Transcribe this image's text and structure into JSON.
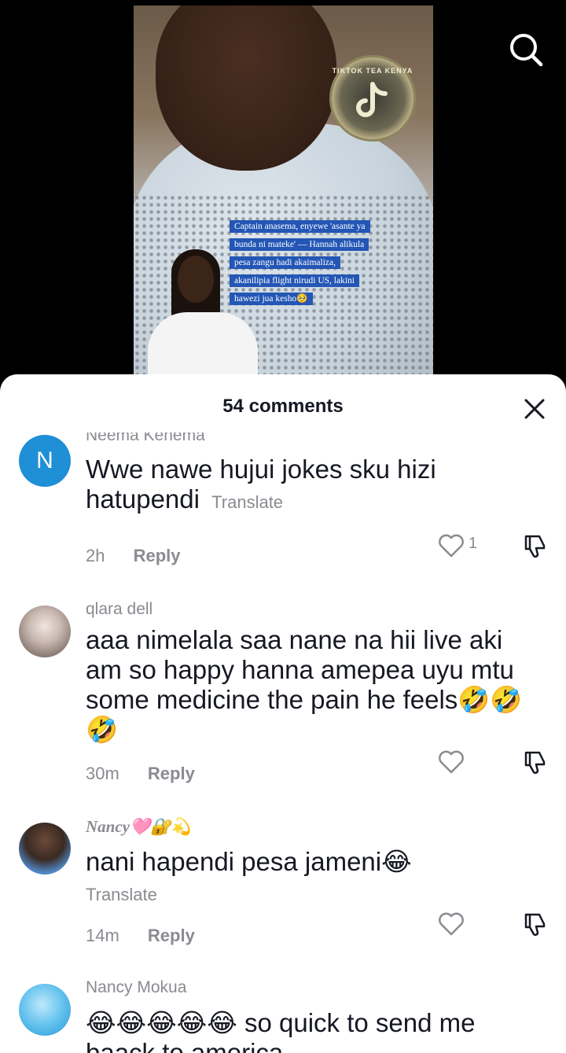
{
  "video": {
    "badge_text": "TIKTOK TEA KENYA",
    "caption_lines": [
      "Captain anasema, enyewe 'asante ya",
      "bunda ni mateke' — Hannah alikula",
      "pesa zangu hadi akaimaliza,",
      "akanilipia flight nirudi US, lakini",
      "hawezi jua kesho🥺"
    ]
  },
  "sheet": {
    "title": "54 comments"
  },
  "comments": [
    {
      "avatar_letter": "N",
      "avatar_color": "#1f8fd6",
      "username": "Neema Kenema",
      "text": "Wwe nawe hujui jokes sku hizi hatupendi",
      "translate": "Translate",
      "time": "2h",
      "reply": "Reply",
      "likes": "1"
    },
    {
      "username": "qlara dell",
      "text": "aaa nimelala saa nane na hii live aki am so happy hanna amepea uyu mtu some medicine the pain he feels🤣🤣🤣",
      "time": "30m",
      "reply": "Reply",
      "likes": ""
    },
    {
      "username": "Nancy🩷🔐💫",
      "text": "nani hapendi pesa jameni😂",
      "translate": "Translate",
      "time": "14m",
      "reply": "Reply",
      "likes": ""
    },
    {
      "username": "Nancy Mokua",
      "text": "😂😂😂😂😂 so quick to send me baack to america",
      "time": "",
      "reply": "",
      "likes": ""
    }
  ]
}
